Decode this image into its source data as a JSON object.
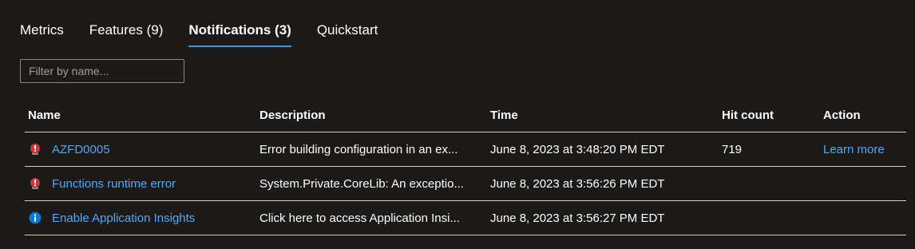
{
  "tabs": [
    {
      "label": "Metrics",
      "active": false
    },
    {
      "label": "Features (9)",
      "active": false
    },
    {
      "label": "Notifications (3)",
      "active": true
    },
    {
      "label": "Quickstart",
      "active": false
    }
  ],
  "filter": {
    "placeholder": "Filter by name...",
    "value": ""
  },
  "table": {
    "headers": {
      "name": "Name",
      "description": "Description",
      "time": "Time",
      "hit_count": "Hit count",
      "action": "Action"
    },
    "rows": [
      {
        "icon": "error-badge-icon",
        "name": "AZFD0005",
        "description": "Error building configuration in an ex...",
        "time": "June 8, 2023 at 3:48:20 PM EDT",
        "hit_count": "719",
        "action": "Learn more"
      },
      {
        "icon": "error-badge-icon",
        "name": "Functions runtime error",
        "description": "System.Private.CoreLib: An exceptio...",
        "time": "June 8, 2023 at 3:56:26 PM EDT",
        "hit_count": "",
        "action": ""
      },
      {
        "icon": "info-icon",
        "name": "Enable Application Insights",
        "description": "Click here to access Application Insi...",
        "time": "June 8, 2023 at 3:56:27 PM EDT",
        "hit_count": "",
        "action": ""
      }
    ]
  },
  "colors": {
    "background": "#1b1a19",
    "accent": "#2899f5",
    "link": "#4fa9f5",
    "error": "#d13438",
    "info": "#0078d4",
    "divider": "#d2d0ce"
  }
}
